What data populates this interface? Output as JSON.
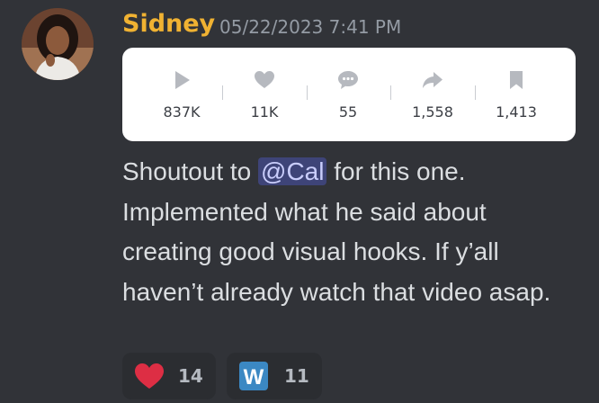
{
  "message": {
    "author": "Sidney",
    "timestamp": "05/22/2023 7:41 PM",
    "text_before_mention": "Shoutout to ",
    "mention": "@Cal",
    "text_after_mention": " for this one. Implemented what he said about creating good visual hooks. If y’all haven’t already watch that video asap."
  },
  "stats": [
    {
      "icon": "play-icon",
      "value": "837K"
    },
    {
      "icon": "heart-icon",
      "value": "11K"
    },
    {
      "icon": "comment-icon",
      "value": "55"
    },
    {
      "icon": "share-icon",
      "value": "1,558"
    },
    {
      "icon": "bookmark-icon",
      "value": "1,413"
    }
  ],
  "reactions": [
    {
      "icon": "heart-emoji-icon",
      "count": "14"
    },
    {
      "icon": "w-emoji-icon",
      "glyph": "W",
      "count": "11"
    }
  ],
  "colors": {
    "background": "#313338",
    "author": "#f0b232",
    "timestamp": "#949ba4",
    "message_text": "#dbdee1",
    "mention_text": "#c9cdfb",
    "reaction_bg": "#2b2d31",
    "stats_card_bg": "#ffffff",
    "stat_icon": "#b6b9bf",
    "heart_emoji": "#dd2e44",
    "w_emoji": "#3b88c3"
  }
}
